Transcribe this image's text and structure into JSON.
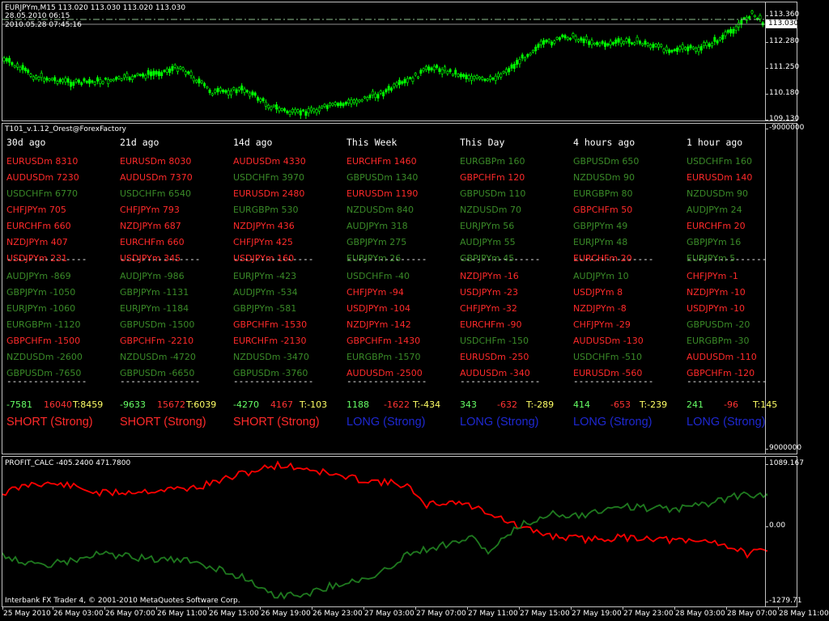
{
  "price_pane": {
    "title": "EURJPYm,M15  113.020 113.030 113.020 113.030",
    "overlay_line1": "28.05.2010 06:15",
    "overlay_line2": "2010.05.28 07:45:16",
    "current_price": "113.030",
    "scale": [
      "113.360",
      "112.280",
      "111.250",
      "110.180",
      "109.130"
    ],
    "line_color": "#00ff00"
  },
  "t101": {
    "title": "T101_v.1.12_Orest@ForexFactory",
    "scale_top": "-9000000",
    "scale_bottom": "9000000",
    "separator": "---------------",
    "columns": [
      {
        "header": "30d ago",
        "rows": [
          {
            "text": "EURUSDm 8310",
            "color": "#ff2a2a"
          },
          {
            "text": "AUDUSDm 7230",
            "color": "#ff2a2a"
          },
          {
            "text": "USDCHFm 6770",
            "color": "#3a8a28"
          },
          {
            "text": "CHFJPYm 705",
            "color": "#ff2a2a"
          },
          {
            "text": "EURCHFm 660",
            "color": "#ff2a2a"
          },
          {
            "text": "NZDJPYm 407",
            "color": "#ff2a2a"
          },
          {
            "text": "USDJPYm 231",
            "color": "#ff2a2a"
          },
          {
            "text": "AUDJPYm -869",
            "color": "#3a8a28"
          },
          {
            "text": "GBPJPYm -1050",
            "color": "#3a8a28"
          },
          {
            "text": "EURJPYm -1060",
            "color": "#3a8a28"
          },
          {
            "text": "EURGBPm -1120",
            "color": "#3a8a28"
          },
          {
            "text": "GBPCHFm -1500",
            "color": "#ff2a2a"
          },
          {
            "text": "NZDUSDm -2600",
            "color": "#3a8a28"
          },
          {
            "text": "GBPUSDm -7650",
            "color": "#3a8a28"
          }
        ],
        "totals": {
          "a": "-7581",
          "a_color": "#66ff66",
          "b": "16040",
          "b_color": "#ff3333",
          "t": "T:8459",
          "t_color": "#ffff66"
        },
        "signal": {
          "text": "SHORT (Strong)",
          "color": "#ff2a2a"
        }
      },
      {
        "header": "21d ago",
        "rows": [
          {
            "text": "EURUSDm 8030",
            "color": "#ff2a2a"
          },
          {
            "text": "AUDUSDm 7370",
            "color": "#ff2a2a"
          },
          {
            "text": "USDCHFm 6540",
            "color": "#3a8a28"
          },
          {
            "text": "CHFJPYm 793",
            "color": "#ff2a2a"
          },
          {
            "text": "NZDJPYm 687",
            "color": "#ff2a2a"
          },
          {
            "text": "EURCHFm 660",
            "color": "#ff2a2a"
          },
          {
            "text": "USDJPYm 345",
            "color": "#ff2a2a"
          },
          {
            "text": "AUDJPYm -986",
            "color": "#3a8a28"
          },
          {
            "text": "GBPJPYm -1131",
            "color": "#3a8a28"
          },
          {
            "text": "EURJPYm -1184",
            "color": "#3a8a28"
          },
          {
            "text": "GBPUSDm -1500",
            "color": "#3a8a28"
          },
          {
            "text": "GBPCHFm -2210",
            "color": "#ff2a2a"
          },
          {
            "text": "NZDUSDm -4720",
            "color": "#3a8a28"
          },
          {
            "text": "GBPUSDm -6650",
            "color": "#3a8a28"
          }
        ],
        "totals": {
          "a": "-9633",
          "a_color": "#66ff66",
          "b": "15672",
          "b_color": "#ff3333",
          "t": "T:6039",
          "t_color": "#ffff66"
        },
        "signal": {
          "text": "SHORT (Strong)",
          "color": "#ff2a2a"
        }
      },
      {
        "header": "14d ago",
        "rows": [
          {
            "text": "AUDUSDm 4330",
            "color": "#ff2a2a"
          },
          {
            "text": "USDCHFm 3970",
            "color": "#3a8a28"
          },
          {
            "text": "EURUSDm 2480",
            "color": "#ff2a2a"
          },
          {
            "text": "EURGBPm 530",
            "color": "#3a8a28"
          },
          {
            "text": "NZDJPYm 436",
            "color": "#ff2a2a"
          },
          {
            "text": "CHFJPYm 425",
            "color": "#ff2a2a"
          },
          {
            "text": "USDJPYm 160",
            "color": "#ff2a2a"
          },
          {
            "text": "EURJPYm -423",
            "color": "#3a8a28"
          },
          {
            "text": "AUDJPYm -534",
            "color": "#3a8a28"
          },
          {
            "text": "GBPJPYm -581",
            "color": "#3a8a28"
          },
          {
            "text": "GBPCHFm -1530",
            "color": "#ff2a2a"
          },
          {
            "text": "EURCHFm -2130",
            "color": "#ff2a2a"
          },
          {
            "text": "NZDUSDm -3470",
            "color": "#3a8a28"
          },
          {
            "text": "GBPUSDm -3760",
            "color": "#3a8a28"
          }
        ],
        "totals": {
          "a": "-4270",
          "a_color": "#66ff66",
          "b": "4167",
          "b_color": "#ff3333",
          "t": "T:-103",
          "t_color": "#ffff66"
        },
        "signal": {
          "text": "SHORT (Strong)",
          "color": "#ff2a2a"
        }
      },
      {
        "header": "This Week",
        "rows": [
          {
            "text": "EURCHFm 1460",
            "color": "#ff2a2a"
          },
          {
            "text": "GBPUSDm 1340",
            "color": "#3a8a28"
          },
          {
            "text": "EURUSDm 1190",
            "color": "#ff2a2a"
          },
          {
            "text": "NZDUSDm 840",
            "color": "#3a8a28"
          },
          {
            "text": "AUDJPYm 318",
            "color": "#3a8a28"
          },
          {
            "text": "GBPJPYm 275",
            "color": "#3a8a28"
          },
          {
            "text": "EURJPYm 26",
            "color": "#3a8a28"
          },
          {
            "text": "USDCHFm -40",
            "color": "#3a8a28"
          },
          {
            "text": "CHFJPYm -94",
            "color": "#ff2a2a"
          },
          {
            "text": "USDJPYm -104",
            "color": "#ff2a2a"
          },
          {
            "text": "NZDJPYm -142",
            "color": "#ff2a2a"
          },
          {
            "text": "GBPCHFm -1430",
            "color": "#ff2a2a"
          },
          {
            "text": "EURGBPm -1570",
            "color": "#3a8a28"
          },
          {
            "text": "AUDUSDm -2500",
            "color": "#ff2a2a"
          }
        ],
        "totals": {
          "a": "1188",
          "a_color": "#66ff66",
          "b": "-1622",
          "b_color": "#ff3333",
          "t": "T:-434",
          "t_color": "#ffff66"
        },
        "signal": {
          "text": "LONG (Strong)",
          "color": "#1e28d2"
        }
      },
      {
        "header": "This Day",
        "rows": [
          {
            "text": "EURGBPm 160",
            "color": "#3a8a28"
          },
          {
            "text": "GBPCHFm 120",
            "color": "#ff2a2a"
          },
          {
            "text": "GBPUSDm 110",
            "color": "#3a8a28"
          },
          {
            "text": "NZDUSDm 70",
            "color": "#3a8a28"
          },
          {
            "text": "EURJPYm 56",
            "color": "#3a8a28"
          },
          {
            "text": "AUDJPYm 55",
            "color": "#3a8a28"
          },
          {
            "text": "GBPJPYm 45",
            "color": "#3a8a28"
          },
          {
            "text": "NZDJPYm -16",
            "color": "#ff2a2a"
          },
          {
            "text": "USDJPYm -23",
            "color": "#ff2a2a"
          },
          {
            "text": "CHFJPYm -32",
            "color": "#ff2a2a"
          },
          {
            "text": "EURCHFm -90",
            "color": "#ff2a2a"
          },
          {
            "text": "USDCHFm -150",
            "color": "#3a8a28"
          },
          {
            "text": "EURUSDm -250",
            "color": "#ff2a2a"
          },
          {
            "text": "AUDUSDm -340",
            "color": "#ff2a2a"
          }
        ],
        "totals": {
          "a": "343",
          "a_color": "#66ff66",
          "b": "-632",
          "b_color": "#ff3333",
          "t": "T:-289",
          "t_color": "#ffff66"
        },
        "signal": {
          "text": "LONG (Strong)",
          "color": "#1e28d2"
        }
      },
      {
        "header": "4 hours ago",
        "rows": [
          {
            "text": "GBPUSDm 650",
            "color": "#3a8a28"
          },
          {
            "text": "NZDUSDm 90",
            "color": "#3a8a28"
          },
          {
            "text": "EURGBPm 80",
            "color": "#3a8a28"
          },
          {
            "text": "GBPCHFm 50",
            "color": "#ff2a2a"
          },
          {
            "text": "GBPJPYm 49",
            "color": "#3a8a28"
          },
          {
            "text": "EURJPYm 48",
            "color": "#3a8a28"
          },
          {
            "text": "EURCHFm 20",
            "color": "#ff2a2a"
          },
          {
            "text": "AUDJPYm 10",
            "color": "#3a8a28"
          },
          {
            "text": "USDJPYm 8",
            "color": "#ff2a2a"
          },
          {
            "text": "NZDJPYm -8",
            "color": "#ff2a2a"
          },
          {
            "text": "CHFJPYm -29",
            "color": "#ff2a2a"
          },
          {
            "text": "AUDUSDm -130",
            "color": "#ff2a2a"
          },
          {
            "text": "USDCHFm -510",
            "color": "#3a8a28"
          },
          {
            "text": "EURUSDm -560",
            "color": "#ff2a2a"
          }
        ],
        "totals": {
          "a": "414",
          "a_color": "#66ff66",
          "b": "-653",
          "b_color": "#ff3333",
          "t": "T:-239",
          "t_color": "#ffff66"
        },
        "signal": {
          "text": "LONG (Strong)",
          "color": "#1e28d2"
        }
      },
      {
        "header": "1 hour ago",
        "rows": [
          {
            "text": "USDCHFm 160",
            "color": "#3a8a28"
          },
          {
            "text": "EURUSDm 140",
            "color": "#ff2a2a"
          },
          {
            "text": "NZDUSDm 90",
            "color": "#3a8a28"
          },
          {
            "text": "AUDJPYm 24",
            "color": "#3a8a28"
          },
          {
            "text": "EURCHFm 20",
            "color": "#ff2a2a"
          },
          {
            "text": "GBPJPYm 16",
            "color": "#3a8a28"
          },
          {
            "text": "EURJPYm 5",
            "color": "#3a8a28"
          },
          {
            "text": "CHFJPYm -1",
            "color": "#ff2a2a"
          },
          {
            "text": "NZDJPYm -10",
            "color": "#ff2a2a"
          },
          {
            "text": "USDJPYm -10",
            "color": "#ff2a2a"
          },
          {
            "text": "GBPUSDm -20",
            "color": "#3a8a28"
          },
          {
            "text": "EURGBPm -30",
            "color": "#3a8a28"
          },
          {
            "text": "AUDUSDm -110",
            "color": "#ff2a2a"
          },
          {
            "text": "GBPCHFm -120",
            "color": "#ff2a2a"
          }
        ],
        "totals": {
          "a": "241",
          "a_color": "#66ff66",
          "b": "-96",
          "b_color": "#ff3333",
          "t": "T:145",
          "t_color": "#ffff66"
        },
        "signal": {
          "text": "LONG (Strong)",
          "color": "#1e28d2"
        }
      }
    ]
  },
  "profit_pane": {
    "title": "PROFIT_CALC -405.2400 471.7800",
    "footer": "Interbank FX Trader 4, © 2001-2010 MetaQuotes Software Corp.",
    "scale": [
      "1089.167",
      "0.00",
      "-1279.71"
    ],
    "red_color": "#ff0000",
    "green_color": "#1f7a1f"
  },
  "x_axis": [
    "25 May 2010",
    "26 May 03:00",
    "26 May 07:00",
    "26 May 11:00",
    "26 May 15:00",
    "26 May 19:00",
    "26 May 23:00",
    "27 May 03:00",
    "27 May 07:00",
    "27 May 11:00",
    "27 May 15:00",
    "27 May 19:00",
    "27 May 23:00",
    "28 May 03:00",
    "28 May 07:00",
    "28 May 11:00"
  ]
}
